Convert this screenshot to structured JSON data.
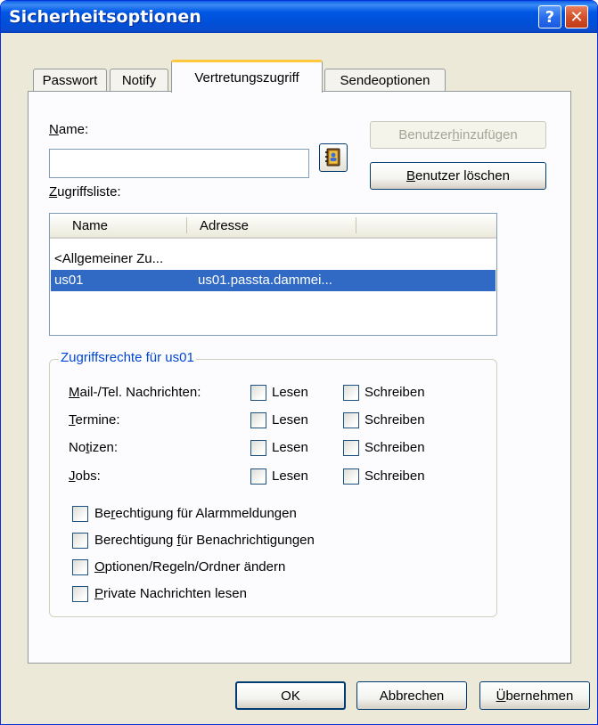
{
  "window": {
    "title": "Sicherheitsoptionen",
    "help_glyph": "?",
    "close_glyph": "✕"
  },
  "tabs": [
    {
      "label": "Passwort",
      "active": false
    },
    {
      "label": "Notify",
      "active": false
    },
    {
      "label": "Vertretungszugriff",
      "active": true
    },
    {
      "label": "Sendeoptionen",
      "active": false
    }
  ],
  "form": {
    "name_label_u": "N",
    "name_label_rest": "ame:",
    "name_value": "",
    "address_book_icon": "address-book-icon",
    "add_user_pre": "Benutzer ",
    "add_user_u": "h",
    "add_user_post": "inzufügen",
    "delete_user_u": "B",
    "delete_user_post": "enutzer löschen",
    "access_list_label_u": "Z",
    "access_list_label_rest": "ugriffsliste:"
  },
  "access_list": {
    "columns": [
      "Name",
      "Adresse"
    ],
    "rows": [
      {
        "name": "<Allgemeiner Zu...",
        "address": "",
        "selected": false
      },
      {
        "name": "us01",
        "address": "us01.passta.dammei...",
        "selected": true
      }
    ]
  },
  "rights": {
    "group_title": "Zugriffsrechte für us01",
    "read_label": "Lesen",
    "write_label": "Schreiben",
    "categories": [
      {
        "u": "M",
        "rest": "ail-/Tel. Nachrichten:",
        "read": false,
        "write": false
      },
      {
        "u": "T",
        "rest": "ermine:",
        "read": false,
        "write": false
      },
      {
        "pre": "No",
        "u": "t",
        "rest": "izen:",
        "read": false,
        "write": false
      },
      {
        "u": "J",
        "rest": "obs:",
        "read": false,
        "write": false
      }
    ],
    "options": [
      {
        "pre": "Be",
        "u": "r",
        "rest": "echtigung für Alarmmeldungen",
        "checked": false
      },
      {
        "pre": "Berechtigung ",
        "u": "f",
        "rest": "ür Benachrichtigungen",
        "checked": false
      },
      {
        "pre": "",
        "u": "O",
        "rest": "ptionen/Regeln/Ordner ändern",
        "checked": false
      },
      {
        "pre": "",
        "u": "P",
        "rest": "rivate Nachrichten lesen",
        "checked": false
      }
    ]
  },
  "footer": {
    "ok": "OK",
    "cancel": "Abbrechen",
    "apply_u": "Ü",
    "apply_rest": "bernehmen"
  }
}
